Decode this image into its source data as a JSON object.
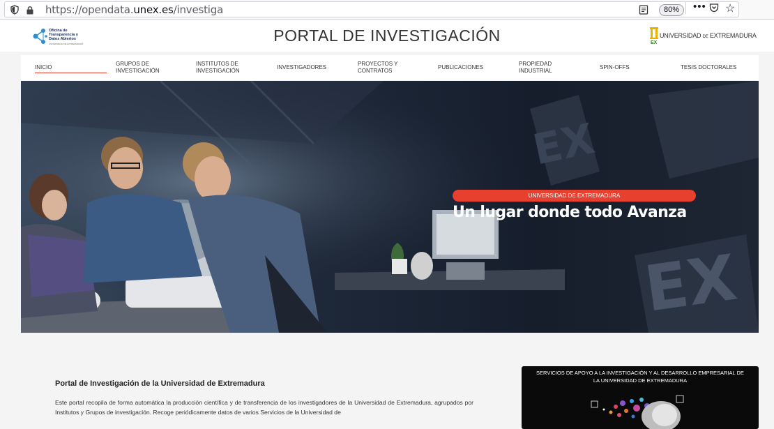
{
  "browser": {
    "url_prefix": "https://opendata.",
    "url_domain": "unex.es",
    "url_path": "/investiga",
    "zoom": "80%"
  },
  "header": {
    "otda_logo_text": "Oficina de Transparencia y Datos Abiertos",
    "otda_logo_sub": "UNIVERSIDAD DE EXTREMADURA",
    "title": "PORTAL DE INVESTIGACIÓN",
    "uex_logo_main": "UNIVERSIDAD",
    "uex_logo_de": "DE",
    "uex_logo_region": "EXTREMADURA"
  },
  "nav": {
    "items": [
      {
        "label": "INICIO"
      },
      {
        "label": "GRUPOS DE INVESTIGACIÓN"
      },
      {
        "label": "INSTITUTOS DE INVESTIGACIÓN"
      },
      {
        "label": "INVESTIGADORES"
      },
      {
        "label": "PROYECTOS Y CONTRATOS"
      },
      {
        "label": "PUBLICACIONES"
      },
      {
        "label": "PROPIEDAD INDUSTRIAL"
      },
      {
        "label": "SPIN-OFFS"
      },
      {
        "label": "TESIS DOCTORALES"
      }
    ]
  },
  "hero": {
    "badge": "UNIVERSIDAD DE EXTREMADURA",
    "headline": "Un lugar donde todo Avanza"
  },
  "intro": {
    "title": "Portal de Investigación de la Universidad de Extremadura",
    "text": "Este portal recopila de forma automática la producción científica y de transferencia de los investigadores de la Universidad de Extremadura, agrupados por Institutos y Grupos de investigación. Recoge periódicamente datos de varios Servicios de la Universidad de"
  },
  "services": {
    "title": "SERVICIOS DE APOYO A LA INVESTIGACIÓN Y AL DESARROLLO EMPRESARIAL DE LA UNIVERSIDAD DE EXTREMADURA"
  },
  "colors": {
    "accent": "#e8402f",
    "hero_dark": "#141c2a"
  }
}
